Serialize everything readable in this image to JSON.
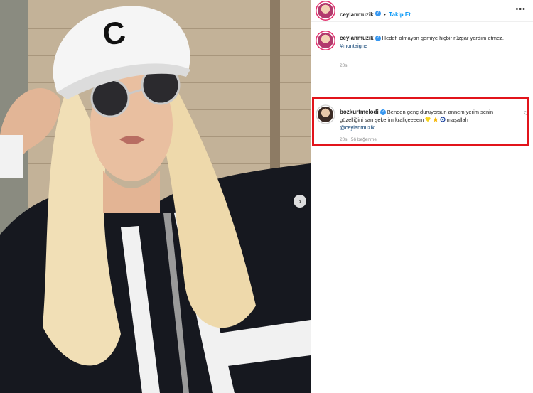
{
  "post": {
    "author": "ceylanmuzik",
    "follow_label": "Takip Et",
    "separator": "•",
    "more_icon": "•••",
    "next_icon": "›",
    "caption": {
      "username": "ceylanmuzik",
      "text": "Hedefi olmayan gemiye hiçbir rüzgar yardım etmez.",
      "hashtag": "#montaigne",
      "time": "20s"
    },
    "comment": {
      "username": "bozkurtmelodi",
      "text_line1": "Benden genç duruyorsun annem yerim senin",
      "text_line2": "güzelliğini sarı şekerim kraliçeeeem",
      "text_line3": "maşallah",
      "mention": "@ceylanmuzik",
      "time": "20s",
      "likes": "56 beğenme",
      "heart_icon": "♡"
    }
  },
  "colors": {
    "highlight": "#e2141b",
    "verified": "#3797f0",
    "follow": "#0095f6"
  }
}
